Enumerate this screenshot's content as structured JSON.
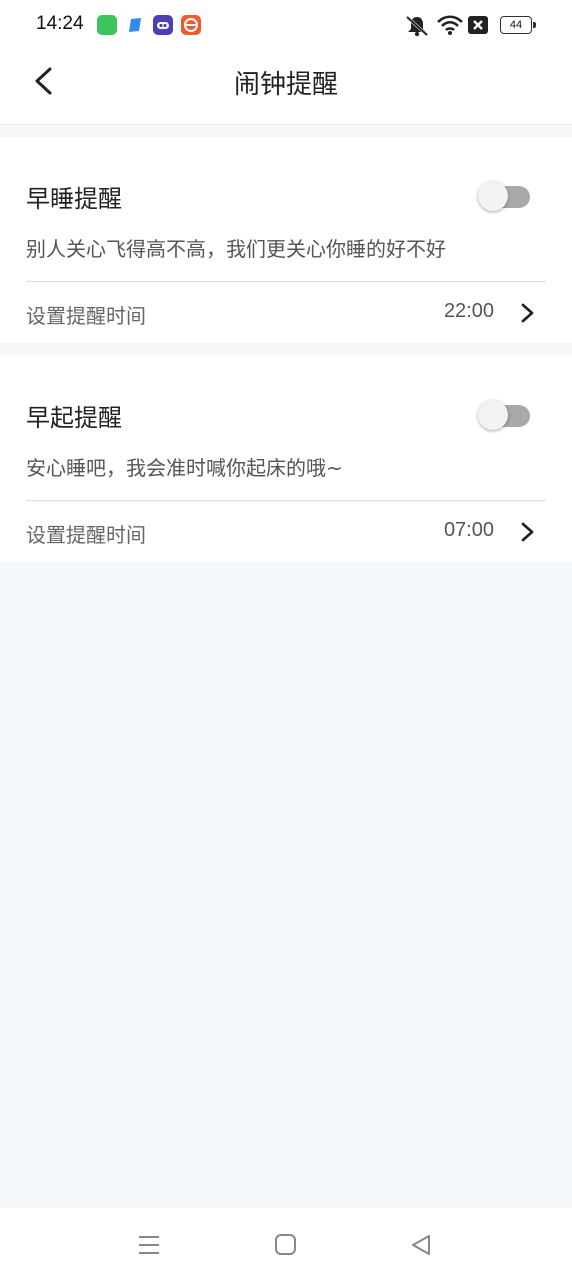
{
  "status_bar": {
    "time": "14:24",
    "battery": "44",
    "icons": [
      "app-green-icon",
      "app-blue-icon",
      "app-purple-icon",
      "app-orange-icon",
      "mute-icon",
      "wifi-icon",
      "signal-off-icon",
      "battery-icon"
    ]
  },
  "header": {
    "title": "闹钟提醒",
    "back_icon": "chevron-left-icon"
  },
  "cards": [
    {
      "title": "早睡提醒",
      "description": "别人关心飞得高不高，我们更关心你睡的好不好",
      "toggle_on": false,
      "row_label": "设置提醒时间",
      "row_value": "22:00"
    },
    {
      "title": "早起提醒",
      "description": "安心睡吧，我会准时喊你起床的哦~",
      "toggle_on": false,
      "row_label": "设置提醒时间",
      "row_value": "07:00"
    }
  ],
  "nav_bar": {
    "icons": [
      "menu-icon",
      "home-icon",
      "back-icon"
    ]
  },
  "colors": {
    "page_background": "#f5f9fc",
    "card_background": "#ffffff",
    "toggle_track": "#a9a9a9",
    "toggle_knob": "#f2f2f2"
  }
}
